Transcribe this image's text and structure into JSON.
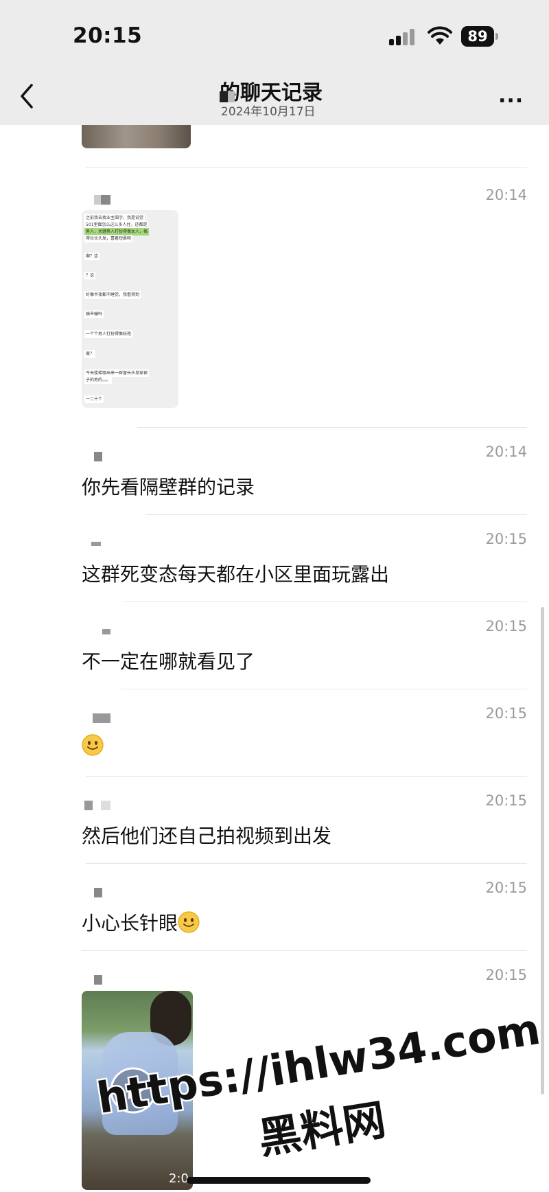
{
  "status_bar": {
    "time": "20:15",
    "battery": "89"
  },
  "nav": {
    "title": "的聊天记录",
    "subtitle": "2024年10月17日",
    "more_label": "..."
  },
  "messages": [
    {
      "time": "20:14",
      "kind": "image"
    },
    {
      "time": "20:14",
      "text": "你先看隔壁群的记录"
    },
    {
      "time": "20:15",
      "text": "这群死变态每天都在小区里面玩露出"
    },
    {
      "time": "20:15",
      "text": "不一定在哪就看见了"
    },
    {
      "time": "20:15",
      "text": ""
    },
    {
      "time": "20:15",
      "text": "然后他们还自己拍视频到出发"
    },
    {
      "time": "20:15",
      "text": "小心长针眼"
    },
    {
      "time": "20:15",
      "kind": "video",
      "duration": "2:0"
    }
  ],
  "thumbnail_lines": [
    "之前我去找业主围字，我是说觉",
    "501里面怎么这么多人住，还都是",
    "男人，关键男人打扮得像女人，搞",
    "得长长头发，喜着短裹吻",
    "啊？这",
    "？说",
    "好像半夜都不睡觉，我看得到",
    "搞市骗吗",
    "一个个男人打扮得像妖艳",
    "黄？",
    "今天楼梯哪出来一群留长头发穿裙",
    "子的男的。。。",
    "一二十个"
  ],
  "watermark": {
    "url": "https://ihlw34.com",
    "name": "黑料网"
  },
  "colors": {
    "nav_bg": "#ececec",
    "timestamp": "#9a9a9a",
    "divider": "#e6e6e6"
  }
}
